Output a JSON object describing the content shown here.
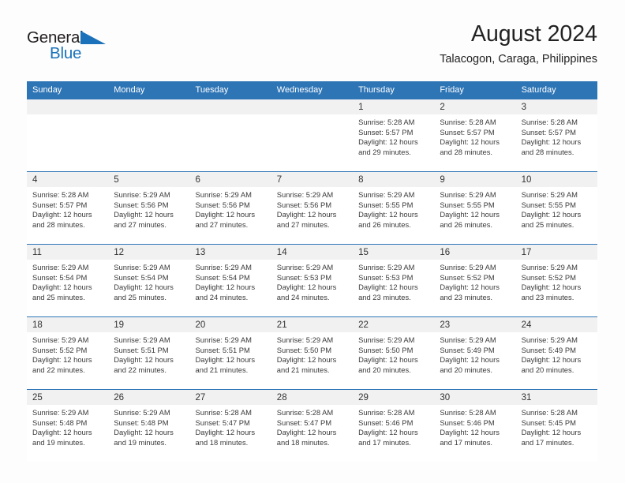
{
  "brand": {
    "name_part1": "General",
    "name_part2": "Blue"
  },
  "header": {
    "title": "August 2024",
    "subtitle": "Talacogon, Caraga, Philippines"
  },
  "colors": {
    "header_blue": "#2E75B6",
    "brand_blue": "#1B72BA",
    "daynum_band": "#F1F1F1",
    "page_background": "#FDFDFD"
  },
  "weekdays": [
    "Sunday",
    "Monday",
    "Tuesday",
    "Wednesday",
    "Thursday",
    "Friday",
    "Saturday"
  ],
  "weeks": [
    [
      {
        "day": "",
        "sunrise": "",
        "sunset": "",
        "daylight_line1": "",
        "daylight_line2": ""
      },
      {
        "day": "",
        "sunrise": "",
        "sunset": "",
        "daylight_line1": "",
        "daylight_line2": ""
      },
      {
        "day": "",
        "sunrise": "",
        "sunset": "",
        "daylight_line1": "",
        "daylight_line2": ""
      },
      {
        "day": "",
        "sunrise": "",
        "sunset": "",
        "daylight_line1": "",
        "daylight_line2": ""
      },
      {
        "day": "1",
        "sunrise": "Sunrise: 5:28 AM",
        "sunset": "Sunset: 5:57 PM",
        "daylight_line1": "Daylight: 12 hours",
        "daylight_line2": "and 29 minutes."
      },
      {
        "day": "2",
        "sunrise": "Sunrise: 5:28 AM",
        "sunset": "Sunset: 5:57 PM",
        "daylight_line1": "Daylight: 12 hours",
        "daylight_line2": "and 28 minutes."
      },
      {
        "day": "3",
        "sunrise": "Sunrise: 5:28 AM",
        "sunset": "Sunset: 5:57 PM",
        "daylight_line1": "Daylight: 12 hours",
        "daylight_line2": "and 28 minutes."
      }
    ],
    [
      {
        "day": "4",
        "sunrise": "Sunrise: 5:28 AM",
        "sunset": "Sunset: 5:57 PM",
        "daylight_line1": "Daylight: 12 hours",
        "daylight_line2": "and 28 minutes."
      },
      {
        "day": "5",
        "sunrise": "Sunrise: 5:29 AM",
        "sunset": "Sunset: 5:56 PM",
        "daylight_line1": "Daylight: 12 hours",
        "daylight_line2": "and 27 minutes."
      },
      {
        "day": "6",
        "sunrise": "Sunrise: 5:29 AM",
        "sunset": "Sunset: 5:56 PM",
        "daylight_line1": "Daylight: 12 hours",
        "daylight_line2": "and 27 minutes."
      },
      {
        "day": "7",
        "sunrise": "Sunrise: 5:29 AM",
        "sunset": "Sunset: 5:56 PM",
        "daylight_line1": "Daylight: 12 hours",
        "daylight_line2": "and 27 minutes."
      },
      {
        "day": "8",
        "sunrise": "Sunrise: 5:29 AM",
        "sunset": "Sunset: 5:55 PM",
        "daylight_line1": "Daylight: 12 hours",
        "daylight_line2": "and 26 minutes."
      },
      {
        "day": "9",
        "sunrise": "Sunrise: 5:29 AM",
        "sunset": "Sunset: 5:55 PM",
        "daylight_line1": "Daylight: 12 hours",
        "daylight_line2": "and 26 minutes."
      },
      {
        "day": "10",
        "sunrise": "Sunrise: 5:29 AM",
        "sunset": "Sunset: 5:55 PM",
        "daylight_line1": "Daylight: 12 hours",
        "daylight_line2": "and 25 minutes."
      }
    ],
    [
      {
        "day": "11",
        "sunrise": "Sunrise: 5:29 AM",
        "sunset": "Sunset: 5:54 PM",
        "daylight_line1": "Daylight: 12 hours",
        "daylight_line2": "and 25 minutes."
      },
      {
        "day": "12",
        "sunrise": "Sunrise: 5:29 AM",
        "sunset": "Sunset: 5:54 PM",
        "daylight_line1": "Daylight: 12 hours",
        "daylight_line2": "and 25 minutes."
      },
      {
        "day": "13",
        "sunrise": "Sunrise: 5:29 AM",
        "sunset": "Sunset: 5:54 PM",
        "daylight_line1": "Daylight: 12 hours",
        "daylight_line2": "and 24 minutes."
      },
      {
        "day": "14",
        "sunrise": "Sunrise: 5:29 AM",
        "sunset": "Sunset: 5:53 PM",
        "daylight_line1": "Daylight: 12 hours",
        "daylight_line2": "and 24 minutes."
      },
      {
        "day": "15",
        "sunrise": "Sunrise: 5:29 AM",
        "sunset": "Sunset: 5:53 PM",
        "daylight_line1": "Daylight: 12 hours",
        "daylight_line2": "and 23 minutes."
      },
      {
        "day": "16",
        "sunrise": "Sunrise: 5:29 AM",
        "sunset": "Sunset: 5:52 PM",
        "daylight_line1": "Daylight: 12 hours",
        "daylight_line2": "and 23 minutes."
      },
      {
        "day": "17",
        "sunrise": "Sunrise: 5:29 AM",
        "sunset": "Sunset: 5:52 PM",
        "daylight_line1": "Daylight: 12 hours",
        "daylight_line2": "and 23 minutes."
      }
    ],
    [
      {
        "day": "18",
        "sunrise": "Sunrise: 5:29 AM",
        "sunset": "Sunset: 5:52 PM",
        "daylight_line1": "Daylight: 12 hours",
        "daylight_line2": "and 22 minutes."
      },
      {
        "day": "19",
        "sunrise": "Sunrise: 5:29 AM",
        "sunset": "Sunset: 5:51 PM",
        "daylight_line1": "Daylight: 12 hours",
        "daylight_line2": "and 22 minutes."
      },
      {
        "day": "20",
        "sunrise": "Sunrise: 5:29 AM",
        "sunset": "Sunset: 5:51 PM",
        "daylight_line1": "Daylight: 12 hours",
        "daylight_line2": "and 21 minutes."
      },
      {
        "day": "21",
        "sunrise": "Sunrise: 5:29 AM",
        "sunset": "Sunset: 5:50 PM",
        "daylight_line1": "Daylight: 12 hours",
        "daylight_line2": "and 21 minutes."
      },
      {
        "day": "22",
        "sunrise": "Sunrise: 5:29 AM",
        "sunset": "Sunset: 5:50 PM",
        "daylight_line1": "Daylight: 12 hours",
        "daylight_line2": "and 20 minutes."
      },
      {
        "day": "23",
        "sunrise": "Sunrise: 5:29 AM",
        "sunset": "Sunset: 5:49 PM",
        "daylight_line1": "Daylight: 12 hours",
        "daylight_line2": "and 20 minutes."
      },
      {
        "day": "24",
        "sunrise": "Sunrise: 5:29 AM",
        "sunset": "Sunset: 5:49 PM",
        "daylight_line1": "Daylight: 12 hours",
        "daylight_line2": "and 20 minutes."
      }
    ],
    [
      {
        "day": "25",
        "sunrise": "Sunrise: 5:29 AM",
        "sunset": "Sunset: 5:48 PM",
        "daylight_line1": "Daylight: 12 hours",
        "daylight_line2": "and 19 minutes."
      },
      {
        "day": "26",
        "sunrise": "Sunrise: 5:29 AM",
        "sunset": "Sunset: 5:48 PM",
        "daylight_line1": "Daylight: 12 hours",
        "daylight_line2": "and 19 minutes."
      },
      {
        "day": "27",
        "sunrise": "Sunrise: 5:28 AM",
        "sunset": "Sunset: 5:47 PM",
        "daylight_line1": "Daylight: 12 hours",
        "daylight_line2": "and 18 minutes."
      },
      {
        "day": "28",
        "sunrise": "Sunrise: 5:28 AM",
        "sunset": "Sunset: 5:47 PM",
        "daylight_line1": "Daylight: 12 hours",
        "daylight_line2": "and 18 minutes."
      },
      {
        "day": "29",
        "sunrise": "Sunrise: 5:28 AM",
        "sunset": "Sunset: 5:46 PM",
        "daylight_line1": "Daylight: 12 hours",
        "daylight_line2": "and 17 minutes."
      },
      {
        "day": "30",
        "sunrise": "Sunrise: 5:28 AM",
        "sunset": "Sunset: 5:46 PM",
        "daylight_line1": "Daylight: 12 hours",
        "daylight_line2": "and 17 minutes."
      },
      {
        "day": "31",
        "sunrise": "Sunrise: 5:28 AM",
        "sunset": "Sunset: 5:45 PM",
        "daylight_line1": "Daylight: 12 hours",
        "daylight_line2": "and 17 minutes."
      }
    ]
  ]
}
